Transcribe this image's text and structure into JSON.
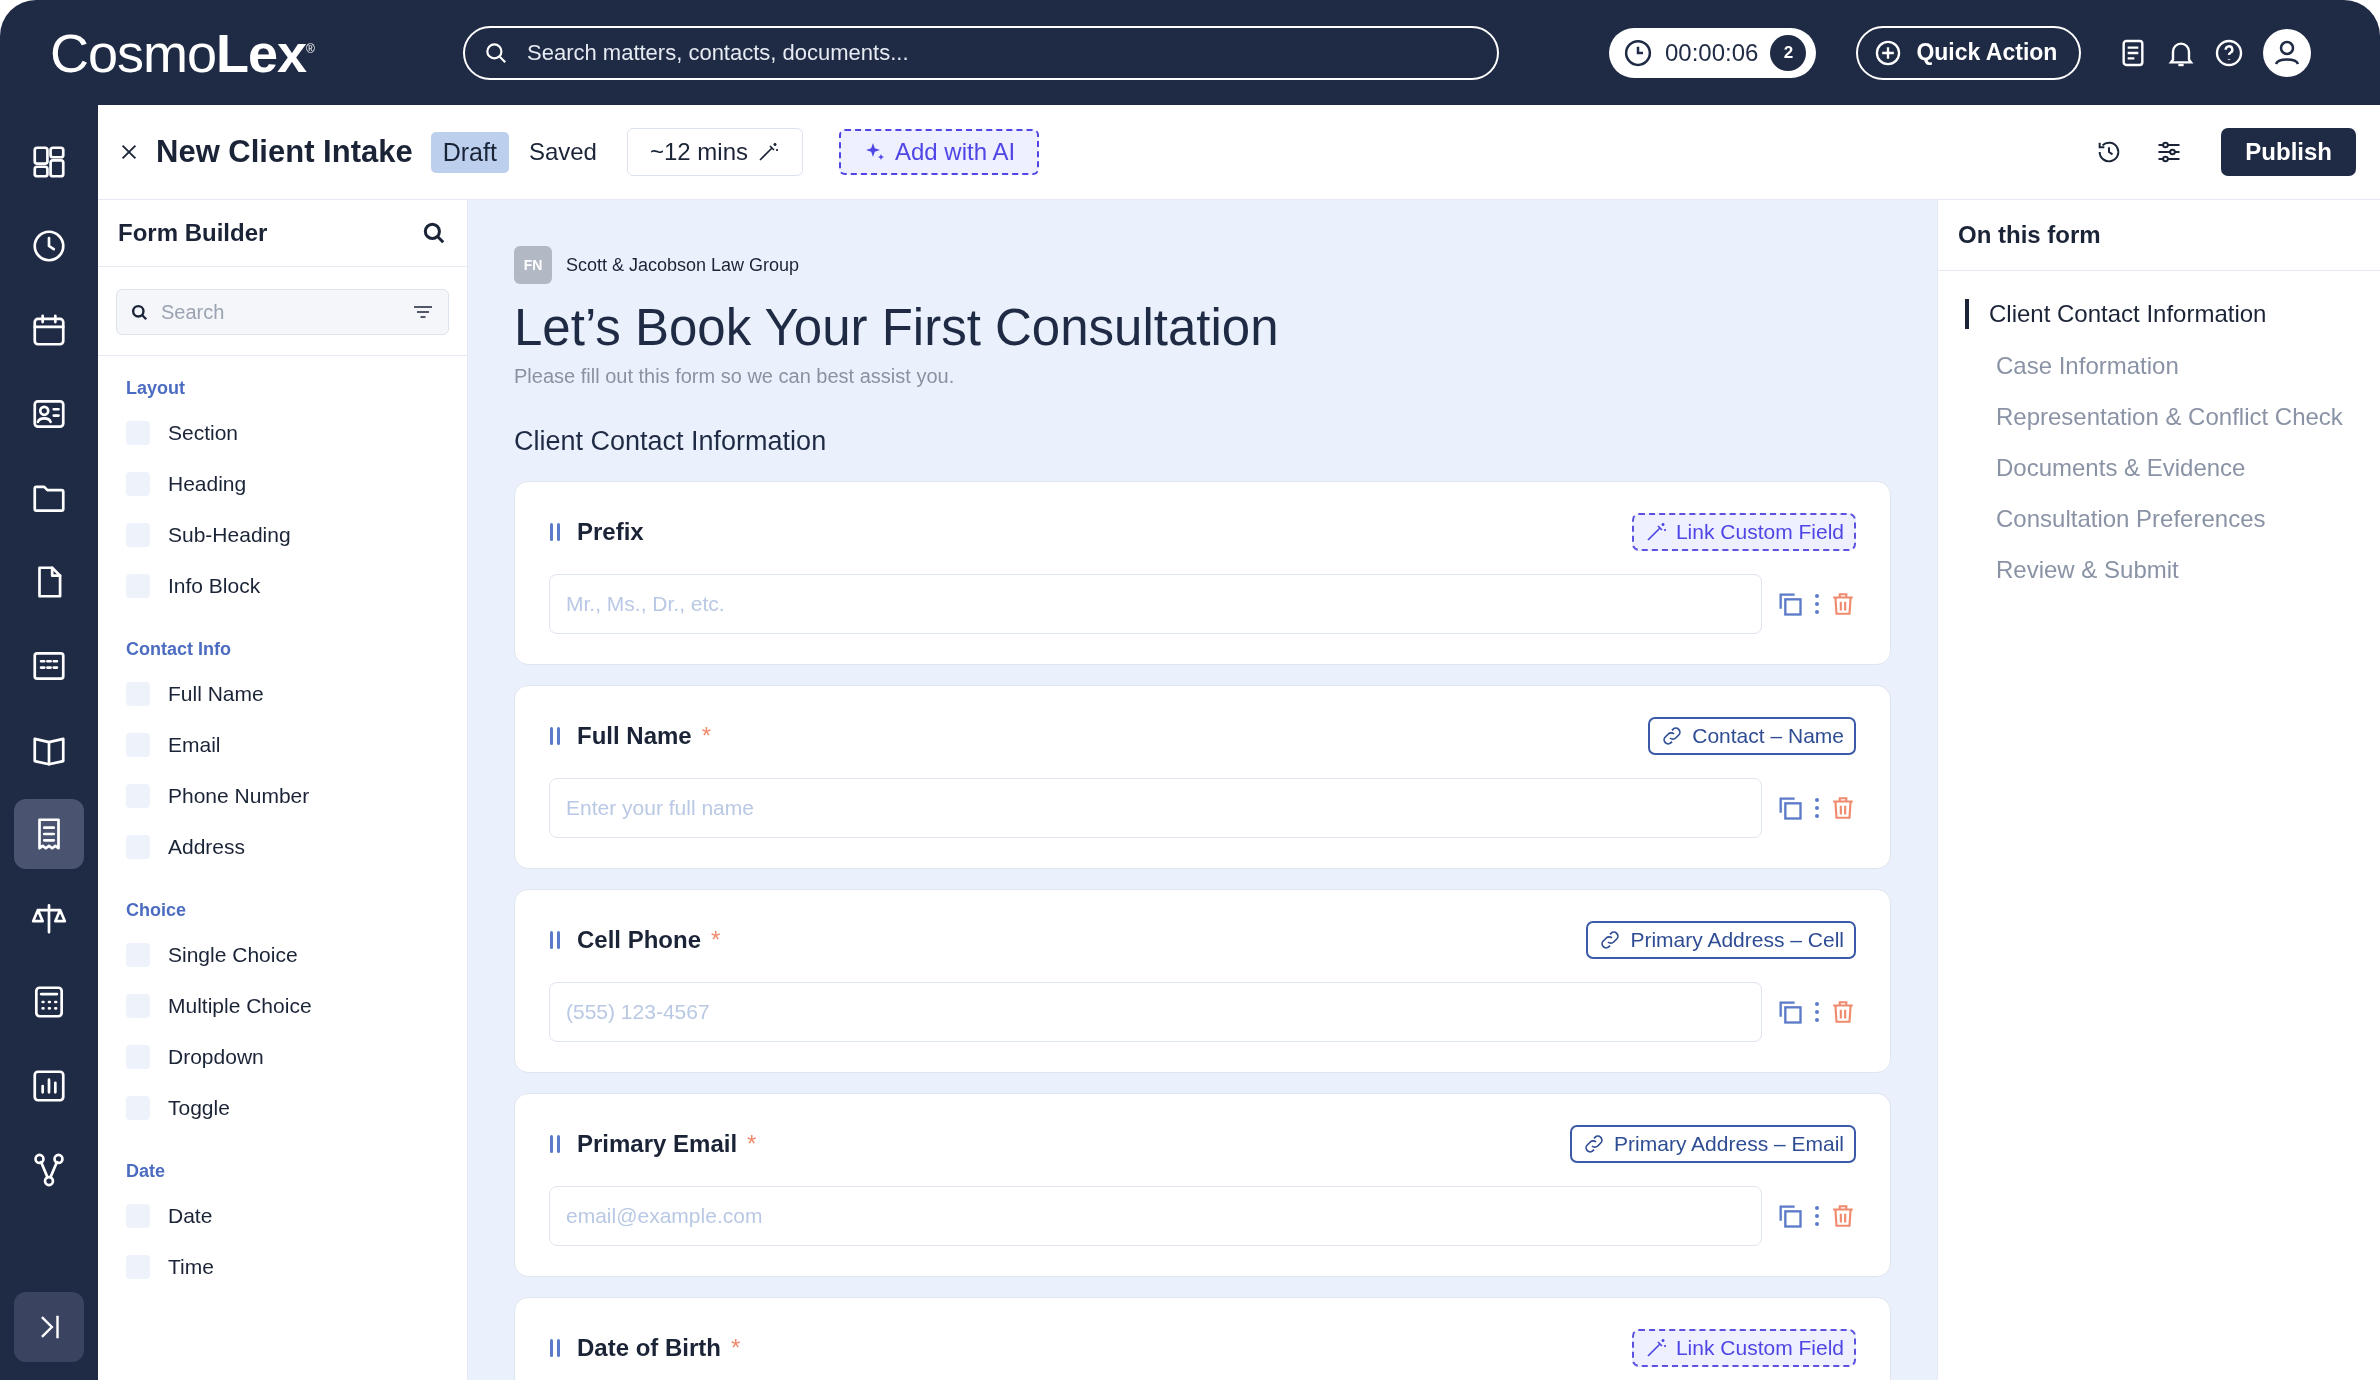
{
  "top_bar": {
    "logo": "Cosmo**Lex**$^{®}$",
    "search": {
      "placeholder": "Search matters, contacts, documents..."
    },
    "timer": {
      "time": "00:00:06",
      "count": "2"
    },
    "quick_action": "Quick Action"
  },
  "rail": [
    {
      "selected": false
    },
    {
      "selected": false
    },
    {
      "selected": false
    },
    {
      "selected": false
    },
    {
      "selected": false
    },
    {
      "selected": false
    },
    {
      "selected": false
    },
    {
      "selected": false
    },
    {
      "selected": true
    },
    {
      "selected": false
    },
    {
      "selected": false
    },
    {
      "selected": false
    },
    {
      "selected": false
    }
  ],
  "editor_header": {
    "title": "New Client Intake",
    "status": "Draft",
    "save_state": "Saved",
    "estimate": "~12 mins",
    "ai_button": "Add with AI",
    "publish": "Publish"
  },
  "form_builder": {
    "title": "Form Builder",
    "search": {
      "placeholder": "Search"
    },
    "groups": [
      {
        "heading": "Layout",
        "items": [
          "Section",
          "Heading",
          "Sub-Heading",
          "Info Block"
        ]
      },
      {
        "heading": "Contact Info",
        "items": [
          "Full Name",
          "Email",
          "Phone Number",
          "Address"
        ]
      },
      {
        "heading": "Choice",
        "items": [
          "Single Choice",
          "Multiple Choice",
          "Dropdown",
          "Toggle"
        ]
      },
      {
        "heading": "Date",
        "items": [
          "Date",
          "Time"
        ]
      }
    ]
  },
  "form": {
    "org_initials": "FN",
    "org_name": "Scott & Jacobson Law Group",
    "title": "Let’s Book Your First Consultation",
    "subtitle": "Please fill out this form so we can best assist you.",
    "section": "Client Contact Information",
    "fields": [
      {
        "label": "Prefix",
        "placeholder": "Mr., Ms., Dr., etc.",
        "link": {
          "kind": "custom",
          "text": "Link Custom Field"
        }
      },
      {
        "label": "Full Name",
        "required_mark": "*",
        "placeholder": "Enter your full name",
        "link": {
          "kind": "linked",
          "text": "Contact – Name"
        }
      },
      {
        "label": "Cell Phone",
        "required_mark": "*",
        "placeholder": "(555) 123-4567",
        "link": {
          "kind": "linked",
          "text": "Primary Address – Cell"
        }
      },
      {
        "label": "Primary Email",
        "required_mark": "*",
        "placeholder": "email@example.com",
        "link": {
          "kind": "linked",
          "text": "Primary Address – Email"
        }
      },
      {
        "label": "Date of Birth",
        "required_mark": "*",
        "link": {
          "kind": "custom",
          "text": "Link Custom Field"
        }
      }
    ]
  },
  "outline": {
    "title": "On this form",
    "items": [
      {
        "label": "Client Contact Information",
        "selected": true
      },
      {
        "label": "Case Information",
        "selected": false
      },
      {
        "label": "Representation & Conflict Check",
        "selected": false
      },
      {
        "label": "Documents & Evidence",
        "selected": false
      },
      {
        "label": "Consultation Preferences",
        "selected": false
      },
      {
        "label": "Review & Submit",
        "selected": false
      }
    ]
  }
}
